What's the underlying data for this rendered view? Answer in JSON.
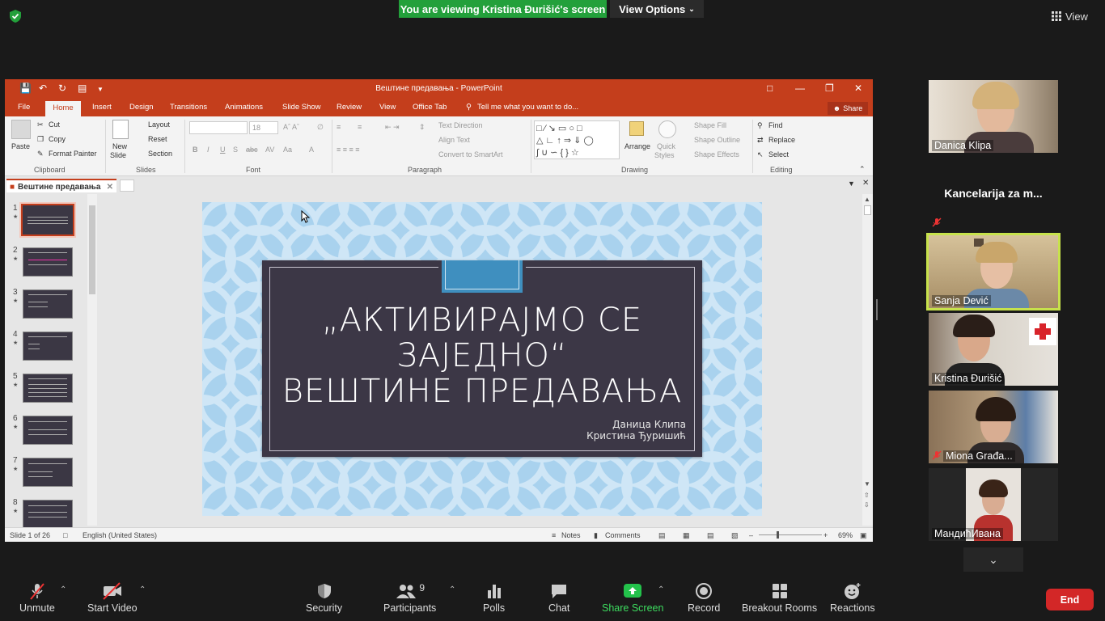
{
  "zoom": {
    "banner": "You are viewing Kristina Đurišić's screen",
    "view_options": "View Options",
    "view_label": "View"
  },
  "ppt": {
    "window_title": "Вештине предавања - PowerPoint",
    "tabs": [
      "File",
      "Home",
      "Insert",
      "Design",
      "Transitions",
      "Animations",
      "Slide Show",
      "Review",
      "View",
      "Office Tab"
    ],
    "tell_me": "Tell me what you want to do...",
    "share": "Share",
    "ribbon": {
      "paste": "Paste",
      "cut": "Cut",
      "copy": "Copy",
      "format_painter": "Format Painter",
      "clipboard": "Clipboard",
      "new_slide_1": "New",
      "new_slide_2": "Slide",
      "layout": "Layout",
      "reset": "Reset",
      "section": "Section",
      "slides": "Slides",
      "font_size": "18",
      "font": "Font",
      "text_direction": "Text Direction",
      "align_text": "Align Text",
      "convert_smartart": "Convert to SmartArt",
      "paragraph": "Paragraph",
      "arrange": "Arrange",
      "quick_styles_1": "Quick",
      "quick_styles_2": "Styles",
      "shape_fill": "Shape Fill",
      "shape_outline": "Shape Outline",
      "shape_effects": "Shape Effects",
      "drawing": "Drawing",
      "find": "Find",
      "replace": "Replace",
      "select": "Select",
      "editing": "Editing"
    },
    "doc_tab": "Вештине предавања",
    "thumbnail_numbers": [
      "1",
      "2",
      "3",
      "4",
      "5",
      "6",
      "7",
      "8"
    ],
    "slide": {
      "title_line1": "„АКТИВИРАЈМО СЕ",
      "title_line2": "ЗАЈЕДНО“",
      "title_line3": "ВЕШТИНЕ ПРЕДАВАЊА",
      "author1": "Даница Клипа",
      "author2": "Кристина Ђуришић"
    },
    "status": {
      "slide_of": "Slide 1 of 26",
      "language": "English (United States)",
      "notes": "Notes",
      "comments": "Comments",
      "zoom": "69%"
    }
  },
  "participants": [
    {
      "name": "Danica Klipa"
    },
    {
      "name": "Kancelarija za m..."
    },
    {
      "name": "Sanja Dević"
    },
    {
      "name": "Kristina Đurišić"
    },
    {
      "name": "Miona Građa..."
    },
    {
      "name": "МандићИвана"
    }
  ],
  "toolbar": {
    "unmute": "Unmute",
    "start_video": "Start Video",
    "security": "Security",
    "participants": "Participants",
    "participants_count": "9",
    "polls": "Polls",
    "chat": "Chat",
    "share_screen": "Share Screen",
    "record": "Record",
    "breakout_rooms": "Breakout Rooms",
    "reactions": "Reactions",
    "end": "End"
  }
}
